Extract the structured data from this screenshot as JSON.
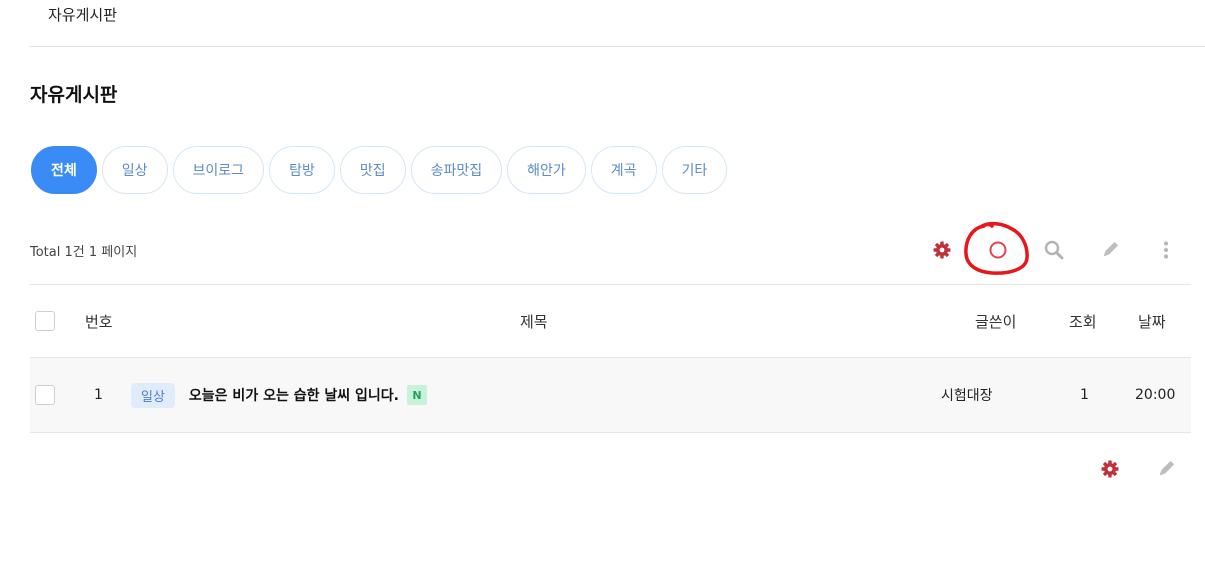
{
  "breadcrumb": "자유게시판",
  "board_title": "자유게시판",
  "categories": [
    {
      "label": "전체",
      "active": true
    },
    {
      "label": "일상"
    },
    {
      "label": "브이로그"
    },
    {
      "label": "탐방"
    },
    {
      "label": "맛집"
    },
    {
      "label": "송파맛집"
    },
    {
      "label": "해안가"
    },
    {
      "label": "계곡"
    },
    {
      "label": "기타"
    }
  ],
  "summary": {
    "total_label": "Total",
    "count": "1건",
    "pages": "1 페이지"
  },
  "toolbar": {
    "icons": [
      "gear-icon",
      "rss-icon",
      "search-icon",
      "pencil-icon",
      "more-vertical-icon"
    ],
    "accent": "#c0303a"
  },
  "table": {
    "headers": {
      "no": "번호",
      "subject": "제목",
      "author": "글쓴이",
      "views": "조회",
      "date": "날짜"
    },
    "rows": [
      {
        "no": "1",
        "category": "일상",
        "subject": "오늘은 비가 오는 습한 날씨 입니다.",
        "new_badge": "N",
        "author": "시험대장",
        "views": "1",
        "date": "20:00"
      }
    ]
  },
  "colors": {
    "primary": "#3b8bf6",
    "category_text": "#5b8cc4",
    "annotation": "#e8151b"
  }
}
